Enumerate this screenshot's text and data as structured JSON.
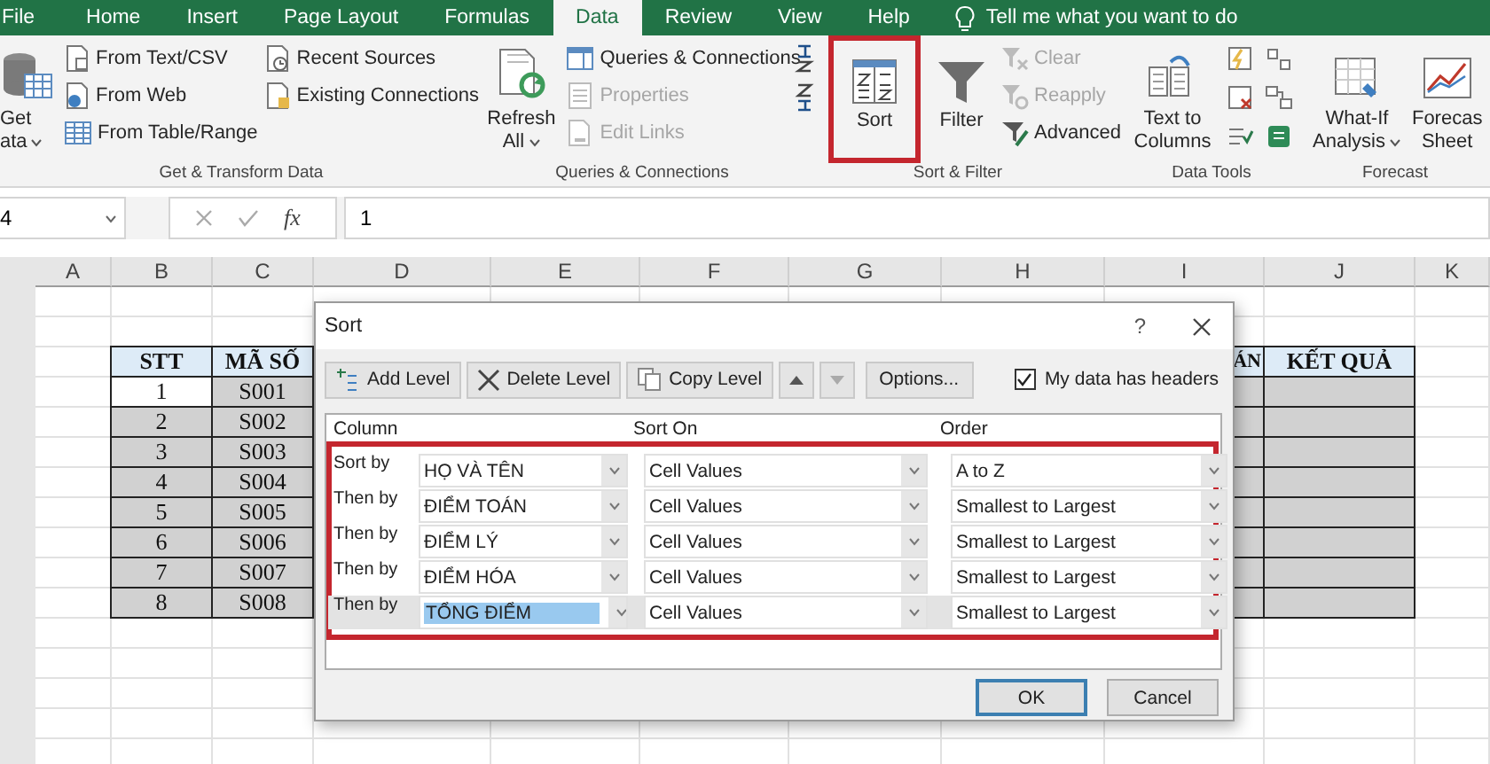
{
  "ribbon": {
    "tabs": [
      {
        "label": "File",
        "selected": false
      },
      {
        "label": "Home",
        "selected": false
      },
      {
        "label": "Insert",
        "selected": false
      },
      {
        "label": "Page Layout",
        "selected": false
      },
      {
        "label": "Formulas",
        "selected": false
      },
      {
        "label": "Data",
        "selected": true
      },
      {
        "label": "Review",
        "selected": false
      },
      {
        "label": "View",
        "selected": false
      },
      {
        "label": "Help",
        "selected": false
      }
    ],
    "tell_me": "Tell me what you want to do",
    "groups": [
      {
        "label": "Get & Transform Data",
        "items": [
          {
            "kind": "large",
            "lines": [
              "Get",
              "ata"
            ],
            "dropdown": true,
            "disabled": false,
            "highlighted": false
          },
          {
            "kind": "stack",
            "children": [
              {
                "kind": "small",
                "label": "From Text/CSV",
                "disabled": false
              },
              {
                "kind": "small",
                "label": "From Web",
                "disabled": false
              },
              {
                "kind": "small",
                "label": "From Table/Range",
                "disabled": false
              }
            ]
          },
          {
            "kind": "stack",
            "children": [
              {
                "kind": "small",
                "label": "Recent Sources",
                "disabled": false
              },
              {
                "kind": "small",
                "label": "Existing Connections",
                "disabled": false
              }
            ]
          }
        ]
      },
      {
        "label": "Queries & Connections",
        "items": [
          {
            "kind": "large",
            "lines": [
              "Refresh",
              "All"
            ],
            "dropdown": true,
            "disabled": false,
            "highlighted": false
          },
          {
            "kind": "stack",
            "children": [
              {
                "kind": "small",
                "label": "Queries & Connections",
                "disabled": false
              },
              {
                "kind": "small",
                "label": "Properties",
                "disabled": true
              },
              {
                "kind": "small",
                "label": "Edit Links",
                "disabled": true
              }
            ]
          }
        ]
      },
      {
        "label": "Sort & Filter",
        "items": [
          {
            "kind": "stack",
            "children": [
              {
                "kind": "icon",
                "disabled": false
              },
              {
                "kind": "icon",
                "disabled": false
              }
            ]
          },
          {
            "kind": "large",
            "lines": [
              "Sort"
            ],
            "dropdown": false,
            "disabled": false,
            "highlighted": true
          },
          {
            "kind": "large",
            "lines": [
              "Filter"
            ],
            "dropdown": false,
            "disabled": false,
            "highlighted": false
          },
          {
            "kind": "stack",
            "children": [
              {
                "kind": "small",
                "label": "Clear",
                "disabled": true
              },
              {
                "kind": "small",
                "label": "Reapply",
                "disabled": true
              },
              {
                "kind": "small",
                "label": "Advanced",
                "disabled": false
              }
            ]
          }
        ]
      },
      {
        "label": "Data Tools",
        "items": [
          {
            "kind": "large",
            "lines": [
              "Text to",
              "Columns"
            ],
            "dropdown": false,
            "disabled": false,
            "highlighted": false
          },
          {
            "kind": "stack",
            "children": [
              {
                "kind": "icon",
                "disabled": false
              },
              {
                "kind": "icon",
                "disabled": false
              },
              {
                "kind": "icon",
                "disabled": false
              }
            ]
          },
          {
            "kind": "stack",
            "children": [
              {
                "kind": "icon",
                "disabled": false
              },
              {
                "kind": "icon",
                "disabled": false
              },
              {
                "kind": "icon",
                "disabled": false
              }
            ]
          }
        ]
      },
      {
        "label": "Forecast",
        "items": [
          {
            "kind": "large",
            "lines": [
              "What-If",
              "Analysis"
            ],
            "dropdown": true,
            "disabled": false,
            "highlighted": false
          },
          {
            "kind": "large",
            "lines": [
              "Forecas",
              "Sheet"
            ],
            "dropdown": false,
            "disabled": false,
            "highlighted": false
          }
        ]
      }
    ]
  },
  "formula_bar": {
    "name_box": "4",
    "function_label": "fx",
    "formula": "1"
  },
  "sheet": {
    "column_headers": [
      "A",
      "B",
      "C",
      "D",
      "E",
      "F",
      "G",
      "H",
      "I",
      "J",
      "K"
    ],
    "table": {
      "columns": [
        "STT",
        "MÃ SỐ"
      ],
      "column_9": "ÁN",
      "column_10": "KẾT QUẢ",
      "rows": [
        {
          "cells": [
            "1",
            "S001"
          ],
          "active": true
        },
        {
          "cells": [
            "2",
            "S002"
          ],
          "active": false
        },
        {
          "cells": [
            "3",
            "S003"
          ],
          "active": false
        },
        {
          "cells": [
            "4",
            "S004"
          ],
          "active": false
        },
        {
          "cells": [
            "5",
            "S005"
          ],
          "active": false
        },
        {
          "cells": [
            "6",
            "S006"
          ],
          "active": false
        },
        {
          "cells": [
            "7",
            "S007"
          ],
          "active": false
        },
        {
          "cells": [
            "8",
            "S008"
          ],
          "active": false
        }
      ]
    }
  },
  "dialog": {
    "title": "Sort",
    "help": "?",
    "toolbar": [
      {
        "kind": "add",
        "label": "Add Level",
        "disabled": false
      },
      {
        "kind": "delete",
        "label": "Delete Level",
        "disabled": false
      },
      {
        "kind": "copy",
        "label": "Copy Level",
        "disabled": false
      },
      {
        "kind": "up",
        "disabled": false
      },
      {
        "kind": "down",
        "disabled": true
      },
      {
        "kind": "text",
        "label": "Options...",
        "disabled": false
      }
    ],
    "headers_checkbox": {
      "label": "My data has headers",
      "checked": true
    },
    "list_headers": [
      "Column",
      "Sort On",
      "Order"
    ],
    "levels_highlighted": true,
    "levels": [
      {
        "label": "Sort by",
        "column": "HỌ VÀ TÊN",
        "sort_on": "Cell Values",
        "order": "A to Z",
        "selected": false
      },
      {
        "label": "Then by",
        "column": "ĐIỂM TOÁN",
        "sort_on": "Cell Values",
        "order": "Smallest to Largest",
        "selected": false
      },
      {
        "label": "Then by",
        "column": "ĐIỂM LÝ",
        "sort_on": "Cell Values",
        "order": "Smallest to Largest",
        "selected": false
      },
      {
        "label": "Then by",
        "column": "ĐIỂM HÓA",
        "sort_on": "Cell Values",
        "order": "Smallest to Largest",
        "selected": false
      },
      {
        "label": "Then by",
        "column": "TỔNG ĐIỂM",
        "sort_on": "Cell Values",
        "order": "Smallest to Largest",
        "selected": true
      }
    ],
    "buttons": [
      {
        "label": "OK",
        "default": true
      },
      {
        "label": "Cancel",
        "default": false
      }
    ]
  }
}
